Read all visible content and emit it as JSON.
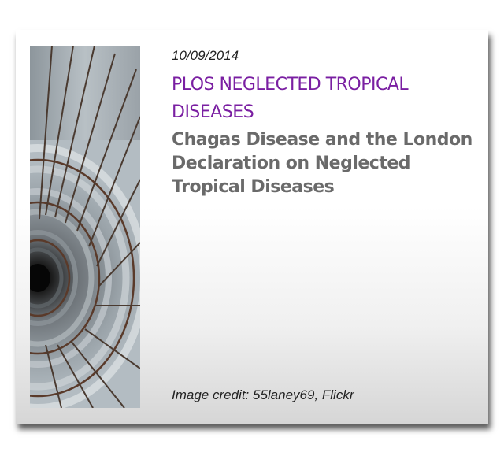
{
  "card": {
    "image_alt": "spiral-staircase",
    "date": "10/09/2014",
    "journal": "PLOS NEGLECTED TROPICAL DISEASES",
    "headline": "Chagas Disease and the London Declaration on Neglected Tropical Diseases",
    "image_credit": "Image credit: 55laney69, Flickr"
  },
  "colors": {
    "journal": "#7a1fa2",
    "headline": "#6a6a6a"
  }
}
